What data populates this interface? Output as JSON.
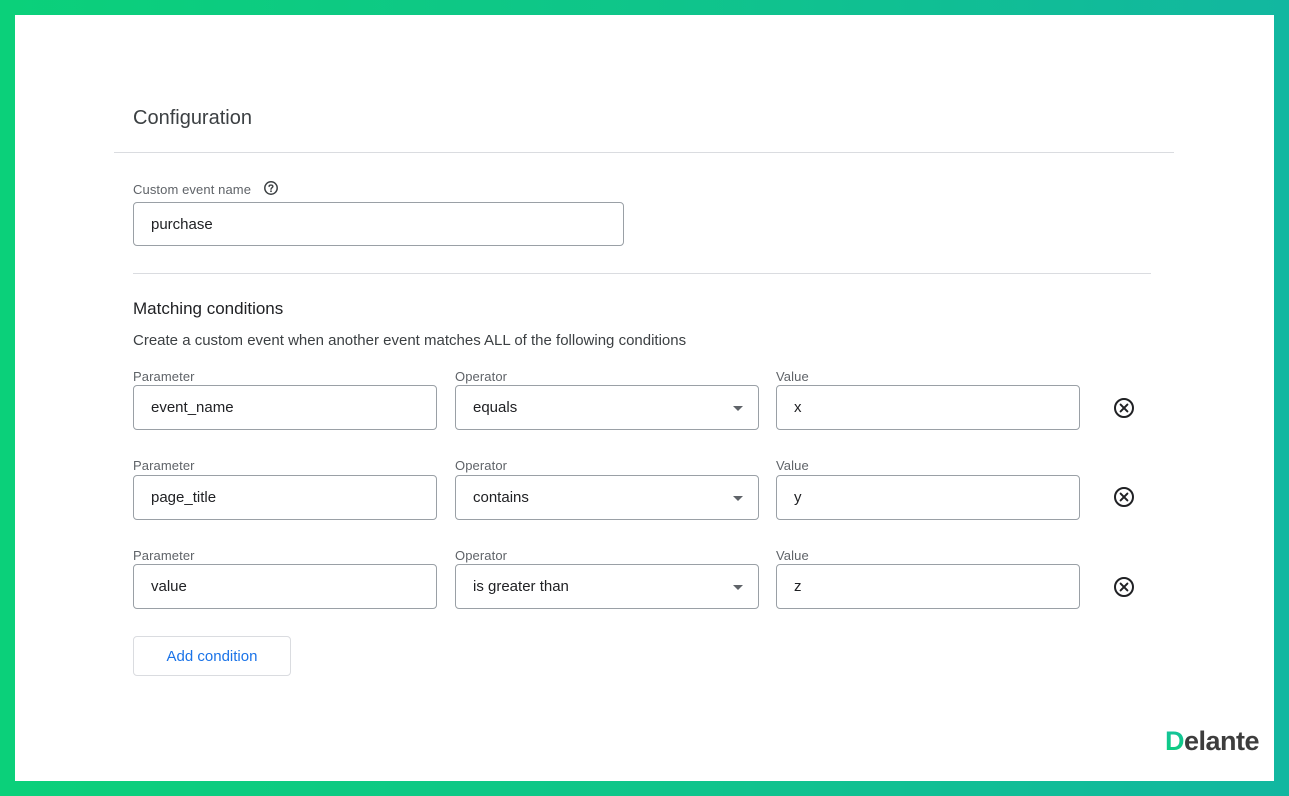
{
  "config": {
    "title": "Configuration"
  },
  "custom_event": {
    "label": "Custom event name",
    "value": "purchase"
  },
  "matching": {
    "title": "Matching conditions",
    "description": "Create a custom event when another event matches ALL of the following conditions",
    "conditions": [
      {
        "parameter_label": "Parameter",
        "parameter": "event_name",
        "operator_label": "Operator",
        "operator": "equals",
        "value_label": "Value",
        "value": "x"
      },
      {
        "parameter_label": "Parameter",
        "parameter": "page_title",
        "operator_label": "Operator",
        "operator": "contains",
        "value_label": "Value",
        "value": "y"
      },
      {
        "parameter_label": "Parameter",
        "parameter": "value",
        "operator_label": "Operator",
        "operator": "is greater than",
        "value_label": "Value",
        "value": "z"
      }
    ],
    "add_button": "Add condition"
  },
  "logo": {
    "first_letter": "D",
    "rest": "elante"
  },
  "colors": {
    "frame_green": "#0bd07a",
    "accent_blue": "#1a73e8"
  },
  "icons": {
    "help": "help-circle-icon",
    "remove": "close-circle-icon",
    "dropdown": "arrow-drop-down-icon"
  }
}
